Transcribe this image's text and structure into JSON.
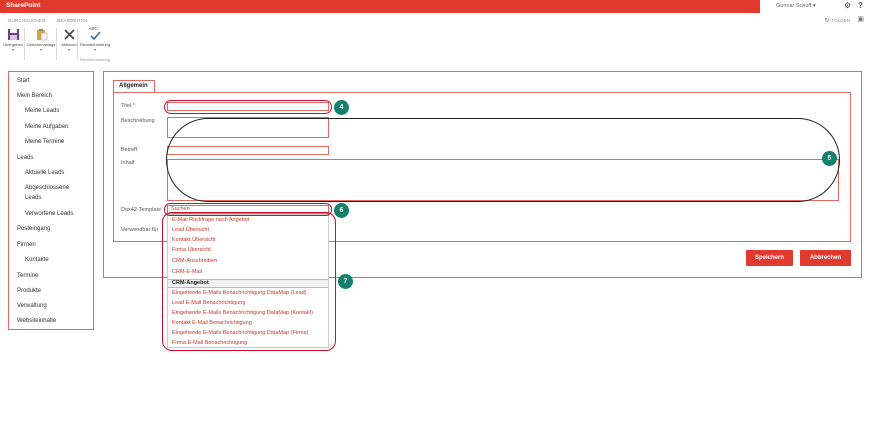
{
  "suite": {
    "brand": "SharePoint",
    "user": "Gunnar Schuff ▾",
    "gear": "⚙",
    "help": "?"
  },
  "ribbon": {
    "tabs": [
      "DURCHSUCHEN",
      "BEARBEITEN"
    ],
    "follow": "FOLGEN",
    "buttons": [
      {
        "label": "Übergeben",
        "icon": "save-icon"
      },
      {
        "label": "Zwischenablage",
        "icon": "clipboard-icon"
      },
      {
        "label": "Aktionen",
        "icon": "cancel-icon"
      },
      {
        "label": "Rechtschreibung",
        "icon": "spellcheck-icon"
      }
    ],
    "spell_abc": "ABC",
    "group_label": "Rechtschreibung"
  },
  "nav": {
    "items": [
      {
        "label": "Start",
        "level": 0
      },
      {
        "label": "Mein Bereich",
        "level": 0
      },
      {
        "label": "Meine Leads",
        "level": 1
      },
      {
        "label": "Meine Aufgaben",
        "level": 1
      },
      {
        "label": "Meine Termine",
        "level": 1
      },
      {
        "label": "Leads",
        "level": 0
      },
      {
        "label": "Aktuelle Leads",
        "level": 1
      },
      {
        "label": "Abgeschlossene",
        "level": 1
      },
      {
        "label": "Leads",
        "level": 1
      },
      {
        "label": "Verworfene Leads",
        "level": 1
      },
      {
        "label": "Posteingang",
        "level": 0
      },
      {
        "label": "Firmen",
        "level": 0
      },
      {
        "label": "Kontakte",
        "level": 1
      },
      {
        "label": "Termine",
        "level": 0
      },
      {
        "label": "Produkte",
        "level": 0
      },
      {
        "label": "Verwaltung",
        "level": 0
      },
      {
        "label": "Websiteinhalte",
        "level": 0
      }
    ]
  },
  "form": {
    "tab": "Allgemein",
    "labels": {
      "titel": "Titel",
      "req": " *",
      "beschreibung": "Beschreibung",
      "betreff": "Betreff",
      "inhalt": "Inhalt",
      "template": "Dox42-Template",
      "verwendbar": "Verwendbar für"
    },
    "search_placeholder": "Suchen",
    "save": "Speichern",
    "cancel": "Abbrechen"
  },
  "dropdown": {
    "items": [
      "E-Mail Rückfrage nach Angebot",
      "Lead Übersicht",
      "Kontakt Übersicht",
      "Firma Übersicht",
      "CRM-Anschreiben",
      "CRM-E-Mail",
      "CRM-Angebot",
      "Eingehende E-Mails Benachrichtigung DataMap (Lead)",
      "Lead E-Mail Benachrichtigung",
      "Eingehende E-Mails Benachrichtigung DataMap (Kontakt)",
      "Kontakt E-Mail Benachrichtigung",
      "Eingehende E-Mails Benachrichtigung DataMap (Firma)",
      "Firma E-Mail Benachrichtigung"
    ],
    "selected_index": 6
  },
  "callouts": [
    "4",
    "5",
    "6",
    "7"
  ],
  "colors": {
    "brand": "#e03a2f",
    "callout_ring": "#c8102e",
    "callout_badge": "#14806e",
    "link": "#c0392b"
  }
}
